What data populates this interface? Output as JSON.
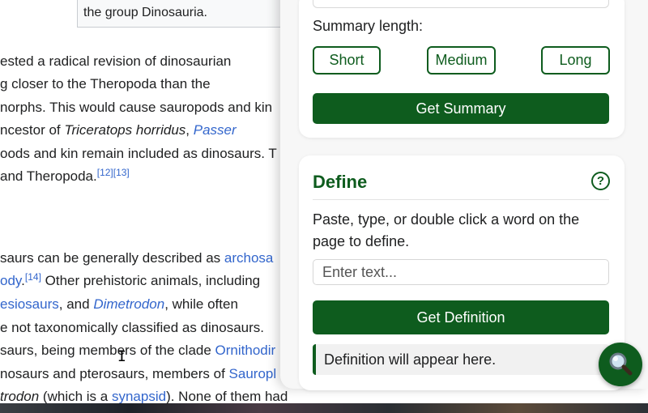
{
  "article": {
    "quote_text": "the group Dinosauria.",
    "lines": [
      {
        "t1": "ested a radical revision of dinosaurian"
      },
      {
        "t1": "g closer to the Theropoda than the"
      },
      {
        "t1": "norphs. This would cause sauropods and kin"
      },
      {
        "t1": "ncestor of ",
        "i1": "Triceratops horridus",
        "t2": ", ",
        "l1": "Passer"
      },
      {
        "t1": "oods and kin remain included as dinosaurs. T"
      },
      {
        "t1": " and Theropoda.",
        "sup": "[12][13]"
      },
      {
        "t1": "saurs can be generally described as ",
        "l1": "archosa"
      },
      {
        "l1": "ody",
        "t1": ".",
        "sup": "[14]",
        "t2": " Other prehistoric animals, including"
      },
      {
        "l1": "esiosaurs",
        "t1": ", and ",
        "li1": "Dimetrodon",
        "t2": ", while often"
      },
      {
        "t1": "e not taxonomically classified as dinosaurs."
      },
      {
        "t1": "saurs, being members of the clade ",
        "l1": "Ornithodir"
      },
      {
        "t1": "nosaurs and pterosaurs, members of ",
        "l1": "Sauropl"
      },
      {
        "i1": "trodon",
        "t1": " (which is a ",
        "l1": "synapsid",
        "t2": "). None of them had"
      }
    ]
  },
  "summary": {
    "length_label": "Summary length:",
    "options": [
      "Short",
      "Medium",
      "Long"
    ],
    "button_label": "Get Summary"
  },
  "define": {
    "title": "Define",
    "help_symbol": "?",
    "description": "Paste, type, or double click a word on the page to define.",
    "input_placeholder": "Enter text...",
    "button_label": "Get Definition",
    "output_text": "Definition will appear here."
  },
  "colors": {
    "accent": "#0e5c1e",
    "link": "#3366cc"
  },
  "icons": {
    "fab": "search-icon",
    "help": "help-icon"
  }
}
